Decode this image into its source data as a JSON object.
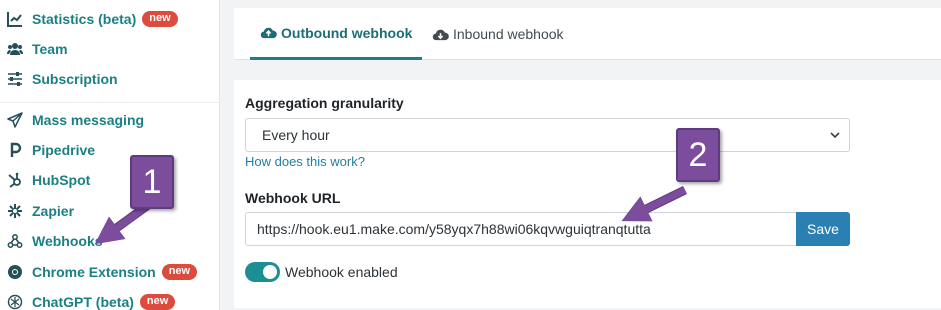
{
  "sidebar": {
    "items": [
      {
        "label": "Statistics (beta)",
        "badge": "new",
        "icon": "chart-line-icon"
      },
      {
        "label": "Team",
        "icon": "users-icon"
      },
      {
        "label": "Subscription",
        "icon": "sliders-icon"
      },
      {
        "label": "Mass messaging",
        "icon": "paper-plane-icon"
      },
      {
        "label": "Pipedrive",
        "icon": "pipedrive-icon"
      },
      {
        "label": "HubSpot",
        "icon": "hubspot-icon"
      },
      {
        "label": "Zapier",
        "icon": "zapier-icon"
      },
      {
        "label": "Webhooks",
        "icon": "webhooks-icon"
      },
      {
        "label": "Chrome Extension",
        "badge": "new",
        "icon": "chrome-icon"
      },
      {
        "label": "ChatGPT (beta)",
        "badge": "new",
        "icon": "openai-icon"
      }
    ]
  },
  "tabs": {
    "outbound": "Outbound webhook",
    "inbound": "Inbound webhook",
    "active": "outbound"
  },
  "form": {
    "aggregation_label": "Aggregation granularity",
    "aggregation_value": "Every hour",
    "help_link": "How does this work?",
    "webhook_url_label": "Webhook URL",
    "webhook_url_value": "https://hook.eu1.make.com/y58yqx7h88wi06kqvwguiqtranqtutta",
    "save_label": "Save",
    "toggle_label": "Webhook enabled",
    "toggle_on": true
  },
  "annotations": {
    "callout_1": "1",
    "callout_2": "2"
  },
  "colors": {
    "accent": "#1b7f84",
    "badge": "#dc4b3c",
    "button": "#2a7fb3",
    "callout": "#7b4d9c"
  }
}
